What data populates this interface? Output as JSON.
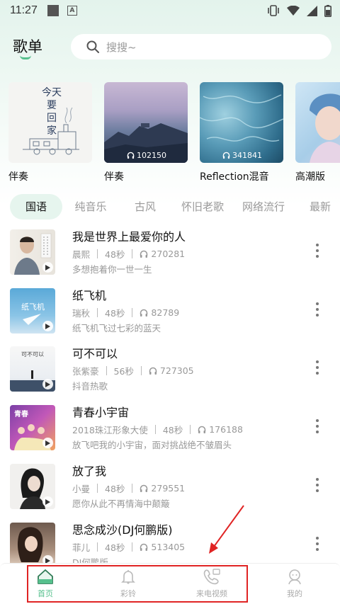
{
  "status_bar": {
    "time": "11:27"
  },
  "header": {
    "title": "歌单",
    "search_placeholder": "搜搜~"
  },
  "playlists": [
    {
      "title": "伴奏",
      "count": "",
      "cover_text": "今天 要 回 家"
    },
    {
      "title": "伴奏",
      "count": "102150"
    },
    {
      "title": "Reflection混音",
      "count": "341841"
    },
    {
      "title": "高潮版",
      "count": ""
    }
  ],
  "tabs": [
    "国语",
    "纯音乐",
    "古风",
    "怀旧老歌",
    "网络流行",
    "最新"
  ],
  "active_tab": "国语",
  "songs": [
    {
      "title": "我是世界上最爱你的人",
      "artist": "晨熙",
      "duration": "48秒",
      "plays": "270281",
      "desc": "多想抱着你一世一生"
    },
    {
      "title": "纸飞机",
      "artist": "瑞秋",
      "duration": "48秒",
      "plays": "82789",
      "desc": "纸飞机飞过七彩的蓝天",
      "cover_text": "纸飞机"
    },
    {
      "title": "可不可以",
      "artist": "张紫豪",
      "duration": "56秒",
      "plays": "727305",
      "desc": "抖音热歌",
      "cover_text": "可不可以"
    },
    {
      "title": "青春小宇宙",
      "artist": "2018珠江形象大使",
      "duration": "48秒",
      "plays": "176188",
      "desc": "放飞吧我的小宇宙，面对挑战绝不皱眉头",
      "cover_text": "青春"
    },
    {
      "title": "放了我",
      "artist": "小曼",
      "duration": "48秒",
      "plays": "279551",
      "desc": "愿你从此不再情海中颠簸"
    },
    {
      "title": "思念成沙(DJ何鹏版)",
      "artist": "菲儿",
      "duration": "48秒",
      "plays": "513405",
      "desc": "DJ何鹏版"
    }
  ],
  "bottom_nav": [
    {
      "label": "首页",
      "icon": "home-icon",
      "active": true
    },
    {
      "label": "彩铃",
      "icon": "bell-icon",
      "active": false
    },
    {
      "label": "来电视频",
      "icon": "phone-video-icon",
      "active": false
    },
    {
      "label": "我的",
      "icon": "profile-icon",
      "active": false
    }
  ],
  "colors": {
    "accent": "#56c08d",
    "annotation": "#e02424"
  }
}
